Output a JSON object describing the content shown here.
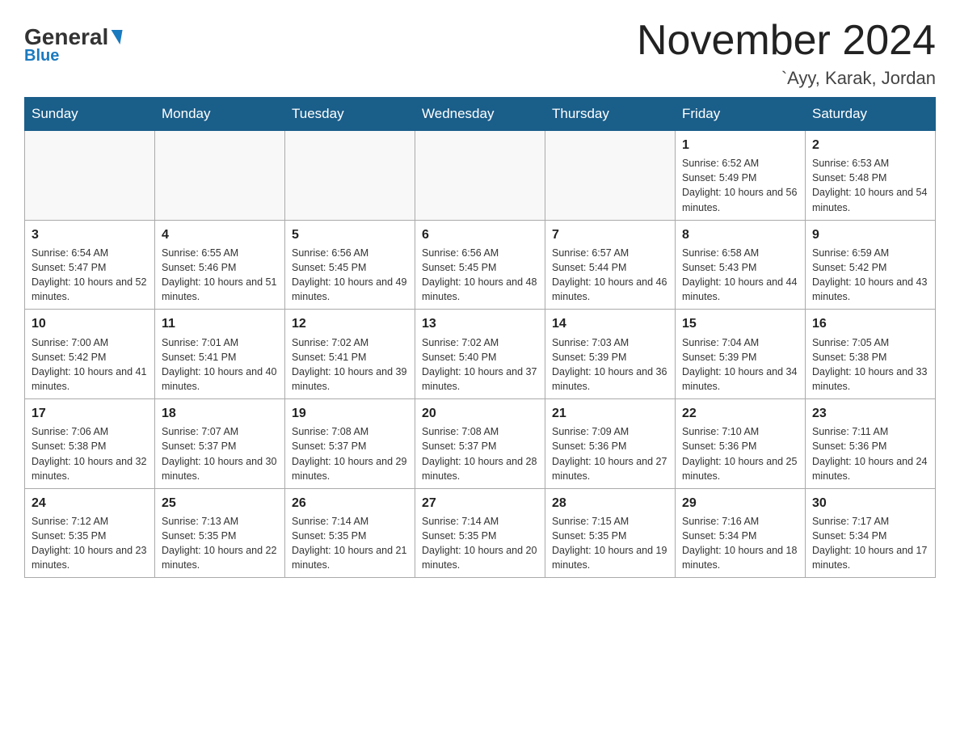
{
  "header": {
    "logo_general": "General",
    "logo_blue": "Blue",
    "title": "November 2024",
    "subtitle": "`Ayy, Karak, Jordan"
  },
  "days_of_week": [
    "Sunday",
    "Monday",
    "Tuesday",
    "Wednesday",
    "Thursday",
    "Friday",
    "Saturday"
  ],
  "weeks": [
    [
      {
        "day": "",
        "sunrise": "",
        "sunset": "",
        "daylight": ""
      },
      {
        "day": "",
        "sunrise": "",
        "sunset": "",
        "daylight": ""
      },
      {
        "day": "",
        "sunrise": "",
        "sunset": "",
        "daylight": ""
      },
      {
        "day": "",
        "sunrise": "",
        "sunset": "",
        "daylight": ""
      },
      {
        "day": "",
        "sunrise": "",
        "sunset": "",
        "daylight": ""
      },
      {
        "day": "1",
        "sunrise": "Sunrise: 6:52 AM",
        "sunset": "Sunset: 5:49 PM",
        "daylight": "Daylight: 10 hours and 56 minutes."
      },
      {
        "day": "2",
        "sunrise": "Sunrise: 6:53 AM",
        "sunset": "Sunset: 5:48 PM",
        "daylight": "Daylight: 10 hours and 54 minutes."
      }
    ],
    [
      {
        "day": "3",
        "sunrise": "Sunrise: 6:54 AM",
        "sunset": "Sunset: 5:47 PM",
        "daylight": "Daylight: 10 hours and 52 minutes."
      },
      {
        "day": "4",
        "sunrise": "Sunrise: 6:55 AM",
        "sunset": "Sunset: 5:46 PM",
        "daylight": "Daylight: 10 hours and 51 minutes."
      },
      {
        "day": "5",
        "sunrise": "Sunrise: 6:56 AM",
        "sunset": "Sunset: 5:45 PM",
        "daylight": "Daylight: 10 hours and 49 minutes."
      },
      {
        "day": "6",
        "sunrise": "Sunrise: 6:56 AM",
        "sunset": "Sunset: 5:45 PM",
        "daylight": "Daylight: 10 hours and 48 minutes."
      },
      {
        "day": "7",
        "sunrise": "Sunrise: 6:57 AM",
        "sunset": "Sunset: 5:44 PM",
        "daylight": "Daylight: 10 hours and 46 minutes."
      },
      {
        "day": "8",
        "sunrise": "Sunrise: 6:58 AM",
        "sunset": "Sunset: 5:43 PM",
        "daylight": "Daylight: 10 hours and 44 minutes."
      },
      {
        "day": "9",
        "sunrise": "Sunrise: 6:59 AM",
        "sunset": "Sunset: 5:42 PM",
        "daylight": "Daylight: 10 hours and 43 minutes."
      }
    ],
    [
      {
        "day": "10",
        "sunrise": "Sunrise: 7:00 AM",
        "sunset": "Sunset: 5:42 PM",
        "daylight": "Daylight: 10 hours and 41 minutes."
      },
      {
        "day": "11",
        "sunrise": "Sunrise: 7:01 AM",
        "sunset": "Sunset: 5:41 PM",
        "daylight": "Daylight: 10 hours and 40 minutes."
      },
      {
        "day": "12",
        "sunrise": "Sunrise: 7:02 AM",
        "sunset": "Sunset: 5:41 PM",
        "daylight": "Daylight: 10 hours and 39 minutes."
      },
      {
        "day": "13",
        "sunrise": "Sunrise: 7:02 AM",
        "sunset": "Sunset: 5:40 PM",
        "daylight": "Daylight: 10 hours and 37 minutes."
      },
      {
        "day": "14",
        "sunrise": "Sunrise: 7:03 AM",
        "sunset": "Sunset: 5:39 PM",
        "daylight": "Daylight: 10 hours and 36 minutes."
      },
      {
        "day": "15",
        "sunrise": "Sunrise: 7:04 AM",
        "sunset": "Sunset: 5:39 PM",
        "daylight": "Daylight: 10 hours and 34 minutes."
      },
      {
        "day": "16",
        "sunrise": "Sunrise: 7:05 AM",
        "sunset": "Sunset: 5:38 PM",
        "daylight": "Daylight: 10 hours and 33 minutes."
      }
    ],
    [
      {
        "day": "17",
        "sunrise": "Sunrise: 7:06 AM",
        "sunset": "Sunset: 5:38 PM",
        "daylight": "Daylight: 10 hours and 32 minutes."
      },
      {
        "day": "18",
        "sunrise": "Sunrise: 7:07 AM",
        "sunset": "Sunset: 5:37 PM",
        "daylight": "Daylight: 10 hours and 30 minutes."
      },
      {
        "day": "19",
        "sunrise": "Sunrise: 7:08 AM",
        "sunset": "Sunset: 5:37 PM",
        "daylight": "Daylight: 10 hours and 29 minutes."
      },
      {
        "day": "20",
        "sunrise": "Sunrise: 7:08 AM",
        "sunset": "Sunset: 5:37 PM",
        "daylight": "Daylight: 10 hours and 28 minutes."
      },
      {
        "day": "21",
        "sunrise": "Sunrise: 7:09 AM",
        "sunset": "Sunset: 5:36 PM",
        "daylight": "Daylight: 10 hours and 27 minutes."
      },
      {
        "day": "22",
        "sunrise": "Sunrise: 7:10 AM",
        "sunset": "Sunset: 5:36 PM",
        "daylight": "Daylight: 10 hours and 25 minutes."
      },
      {
        "day": "23",
        "sunrise": "Sunrise: 7:11 AM",
        "sunset": "Sunset: 5:36 PM",
        "daylight": "Daylight: 10 hours and 24 minutes."
      }
    ],
    [
      {
        "day": "24",
        "sunrise": "Sunrise: 7:12 AM",
        "sunset": "Sunset: 5:35 PM",
        "daylight": "Daylight: 10 hours and 23 minutes."
      },
      {
        "day": "25",
        "sunrise": "Sunrise: 7:13 AM",
        "sunset": "Sunset: 5:35 PM",
        "daylight": "Daylight: 10 hours and 22 minutes."
      },
      {
        "day": "26",
        "sunrise": "Sunrise: 7:14 AM",
        "sunset": "Sunset: 5:35 PM",
        "daylight": "Daylight: 10 hours and 21 minutes."
      },
      {
        "day": "27",
        "sunrise": "Sunrise: 7:14 AM",
        "sunset": "Sunset: 5:35 PM",
        "daylight": "Daylight: 10 hours and 20 minutes."
      },
      {
        "day": "28",
        "sunrise": "Sunrise: 7:15 AM",
        "sunset": "Sunset: 5:35 PM",
        "daylight": "Daylight: 10 hours and 19 minutes."
      },
      {
        "day": "29",
        "sunrise": "Sunrise: 7:16 AM",
        "sunset": "Sunset: 5:34 PM",
        "daylight": "Daylight: 10 hours and 18 minutes."
      },
      {
        "day": "30",
        "sunrise": "Sunrise: 7:17 AM",
        "sunset": "Sunset: 5:34 PM",
        "daylight": "Daylight: 10 hours and 17 minutes."
      }
    ]
  ]
}
